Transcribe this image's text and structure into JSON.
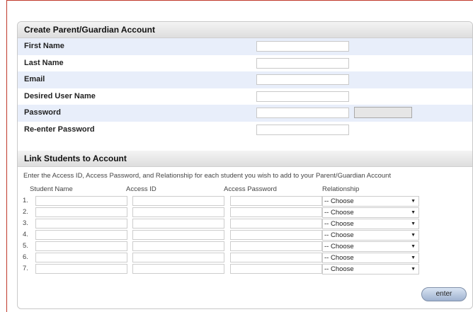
{
  "account": {
    "title": "Create Parent/Guardian Account",
    "fields": [
      {
        "label": "First Name",
        "value": ""
      },
      {
        "label": "Last Name",
        "value": ""
      },
      {
        "label": "Email",
        "value": ""
      },
      {
        "label": "Desired User Name",
        "value": ""
      },
      {
        "label": "Password",
        "value": ""
      },
      {
        "label": "Re-enter Password",
        "value": ""
      }
    ]
  },
  "link": {
    "title": "Link Students to Account",
    "instructions": "Enter the Access ID, Access Password, and Relationship for each student you wish to add to your Parent/Guardian Account",
    "columns": [
      "Student Name",
      "Access ID",
      "Access Password",
      "Relationship"
    ],
    "rows": [
      {
        "num": "1.",
        "relationship": "-- Choose"
      },
      {
        "num": "2.",
        "relationship": "-- Choose"
      },
      {
        "num": "3.",
        "relationship": "-- Choose"
      },
      {
        "num": "4.",
        "relationship": "-- Choose"
      },
      {
        "num": "5.",
        "relationship": "-- Choose"
      },
      {
        "num": "6.",
        "relationship": "-- Choose"
      },
      {
        "num": "7.",
        "relationship": "-- Choose"
      }
    ]
  },
  "enter_label": "enter"
}
